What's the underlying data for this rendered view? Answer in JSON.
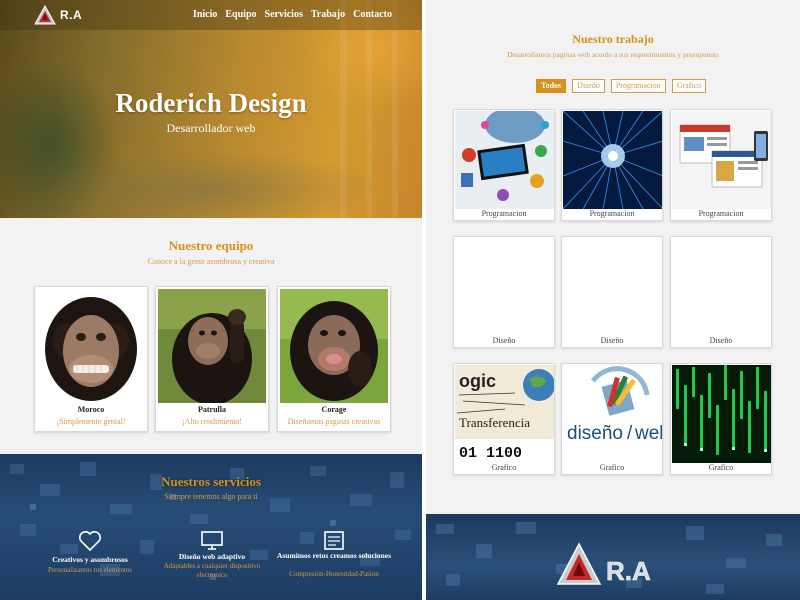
{
  "colors": {
    "accent": "#d4911c",
    "accent_light": "#d49a4a",
    "hero_orange": "#d59a30",
    "services_blue": "#274d77",
    "background": "#f2f2f2"
  },
  "logo": {
    "text": "R.A",
    "icon": "triangle-logo-icon"
  },
  "nav": {
    "items": [
      "Inicio",
      "Equipo",
      "Servicios",
      "Trabajo",
      "Contacto"
    ]
  },
  "hero": {
    "title": "Roderich Design",
    "subtitle": "Desarrollador web"
  },
  "team": {
    "title": "Nuestro equipo",
    "subtitle": "Conoce a la gente asombrosa y creativa",
    "members": [
      {
        "name": "Moroco",
        "role": "¡Simplemente genial!"
      },
      {
        "name": "Patrulla",
        "role": "¡Alto rendimiento!"
      },
      {
        "name": "Corage",
        "role": "Diseñamos paginas creativas"
      }
    ]
  },
  "services": {
    "title": "Nuestros servicios",
    "subtitle": "Siempre tenemos algo para ti",
    "items": [
      {
        "icon": "heart-icon",
        "name": "Creativos y asombrosos",
        "desc": "Personalizamos tus elementos"
      },
      {
        "icon": "monitor-icon",
        "name": "Diseño web adaptivo",
        "desc": "Adaptables a cualquier dispositivo electronico"
      },
      {
        "icon": "newspaper-icon",
        "name": "Asumimos retos creamos soluciones",
        "desc": "Compresión-Honestidad-Pasion"
      }
    ]
  },
  "work": {
    "title": "Nuestro trabajo",
    "subtitle": "Desarrollamos paginas web acorde a sus requerimientos y presupuesto",
    "filters": [
      "Todos",
      "Diseño",
      "Programacion",
      "Grafico"
    ],
    "active_filter": "Todos",
    "projects": [
      {
        "label": "Programacion",
        "thumb": "tech-collage"
      },
      {
        "label": "Programacion",
        "thumb": "data-tunnel"
      },
      {
        "label": "Programacion",
        "thumb": "web-screens"
      },
      {
        "label": "Diseño",
        "thumb": "blank"
      },
      {
        "label": "Diseño",
        "thumb": "blank"
      },
      {
        "label": "Diseño",
        "thumb": "blank"
      },
      {
        "label": "Grafico",
        "thumb": "logic-transfer"
      },
      {
        "label": "Grafico",
        "thumb": "diseno-web"
      },
      {
        "label": "Grafico",
        "thumb": "matrix-code"
      }
    ],
    "thumb_text": {
      "logic": "ogic",
      "transfer": "Transferencia",
      "binary": "01 1100",
      "diseno": "diseño",
      "web": "web"
    }
  },
  "footer": {
    "logo_text": "R.A"
  }
}
